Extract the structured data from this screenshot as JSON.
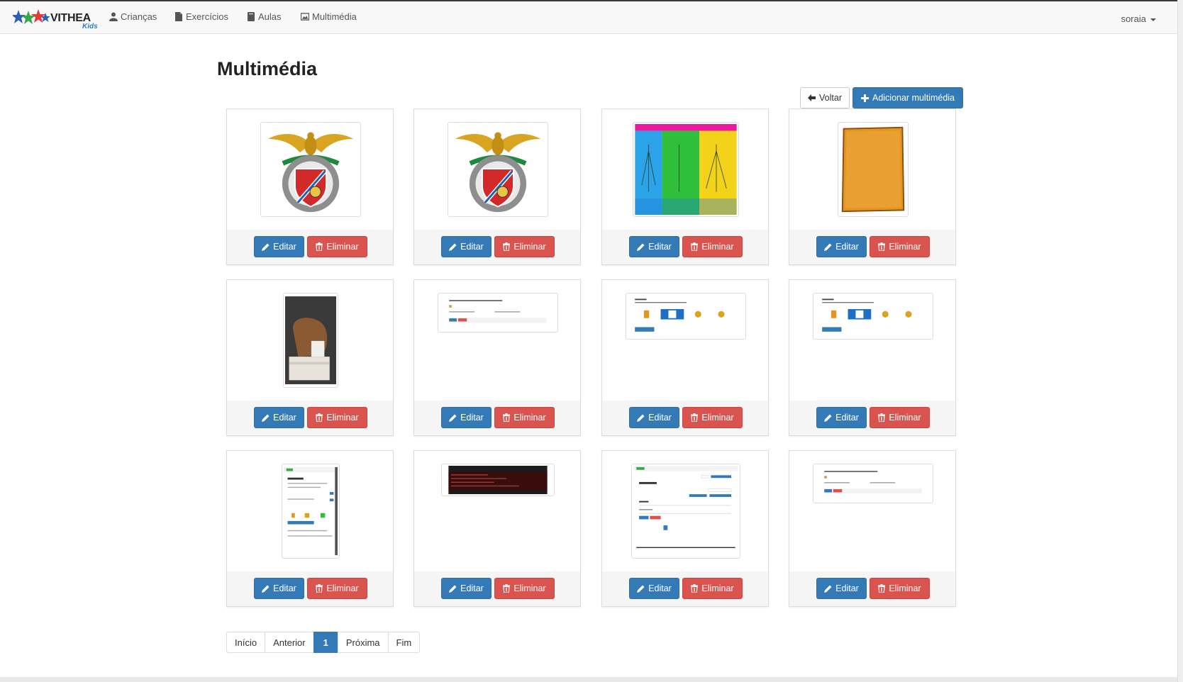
{
  "navbar": {
    "brand": "VITHEA",
    "brand_sub": "Kids",
    "items": [
      {
        "label": "Crianças",
        "icon": "user-icon"
      },
      {
        "label": "Exercícios",
        "icon": "file-icon"
      },
      {
        "label": "Aulas",
        "icon": "book-icon"
      },
      {
        "label": "Multimédia",
        "icon": "picture-icon"
      }
    ],
    "user": "soraia"
  },
  "page": {
    "title": "Multimédia",
    "back_label": "Voltar",
    "add_label": "Adicionar multimédia"
  },
  "cards": [
    {
      "type": "crest",
      "edit": "Editar",
      "delete": "Eliminar"
    },
    {
      "type": "crest",
      "edit": "Editar",
      "delete": "Eliminar"
    },
    {
      "type": "chart-poster",
      "edit": "Editar",
      "delete": "Eliminar"
    },
    {
      "type": "parchment",
      "edit": "Editar",
      "delete": "Eliminar"
    },
    {
      "type": "photo-mask",
      "edit": "Editar",
      "delete": "Eliminar"
    },
    {
      "type": "screenshot-form",
      "edit": "Editar",
      "delete": "Eliminar"
    },
    {
      "type": "screenshot-reforco",
      "edit": "Editar",
      "delete": "Eliminar"
    },
    {
      "type": "screenshot-reforco",
      "edit": "Editar",
      "delete": "Eliminar"
    },
    {
      "type": "screenshot-exercise",
      "edit": "Editar",
      "delete": "Eliminar"
    },
    {
      "type": "screenshot-terminal",
      "edit": "Editar",
      "delete": "Eliminar"
    },
    {
      "type": "screenshot-list",
      "edit": "Editar",
      "delete": "Eliminar"
    },
    {
      "type": "screenshot-form",
      "edit": "Editar",
      "delete": "Eliminar"
    }
  ],
  "pagination": {
    "first": "Início",
    "prev": "Anterior",
    "current": "1",
    "next": "Próxima",
    "last": "Fim"
  },
  "colors": {
    "primary": "#337ab7",
    "danger": "#d9534f"
  }
}
